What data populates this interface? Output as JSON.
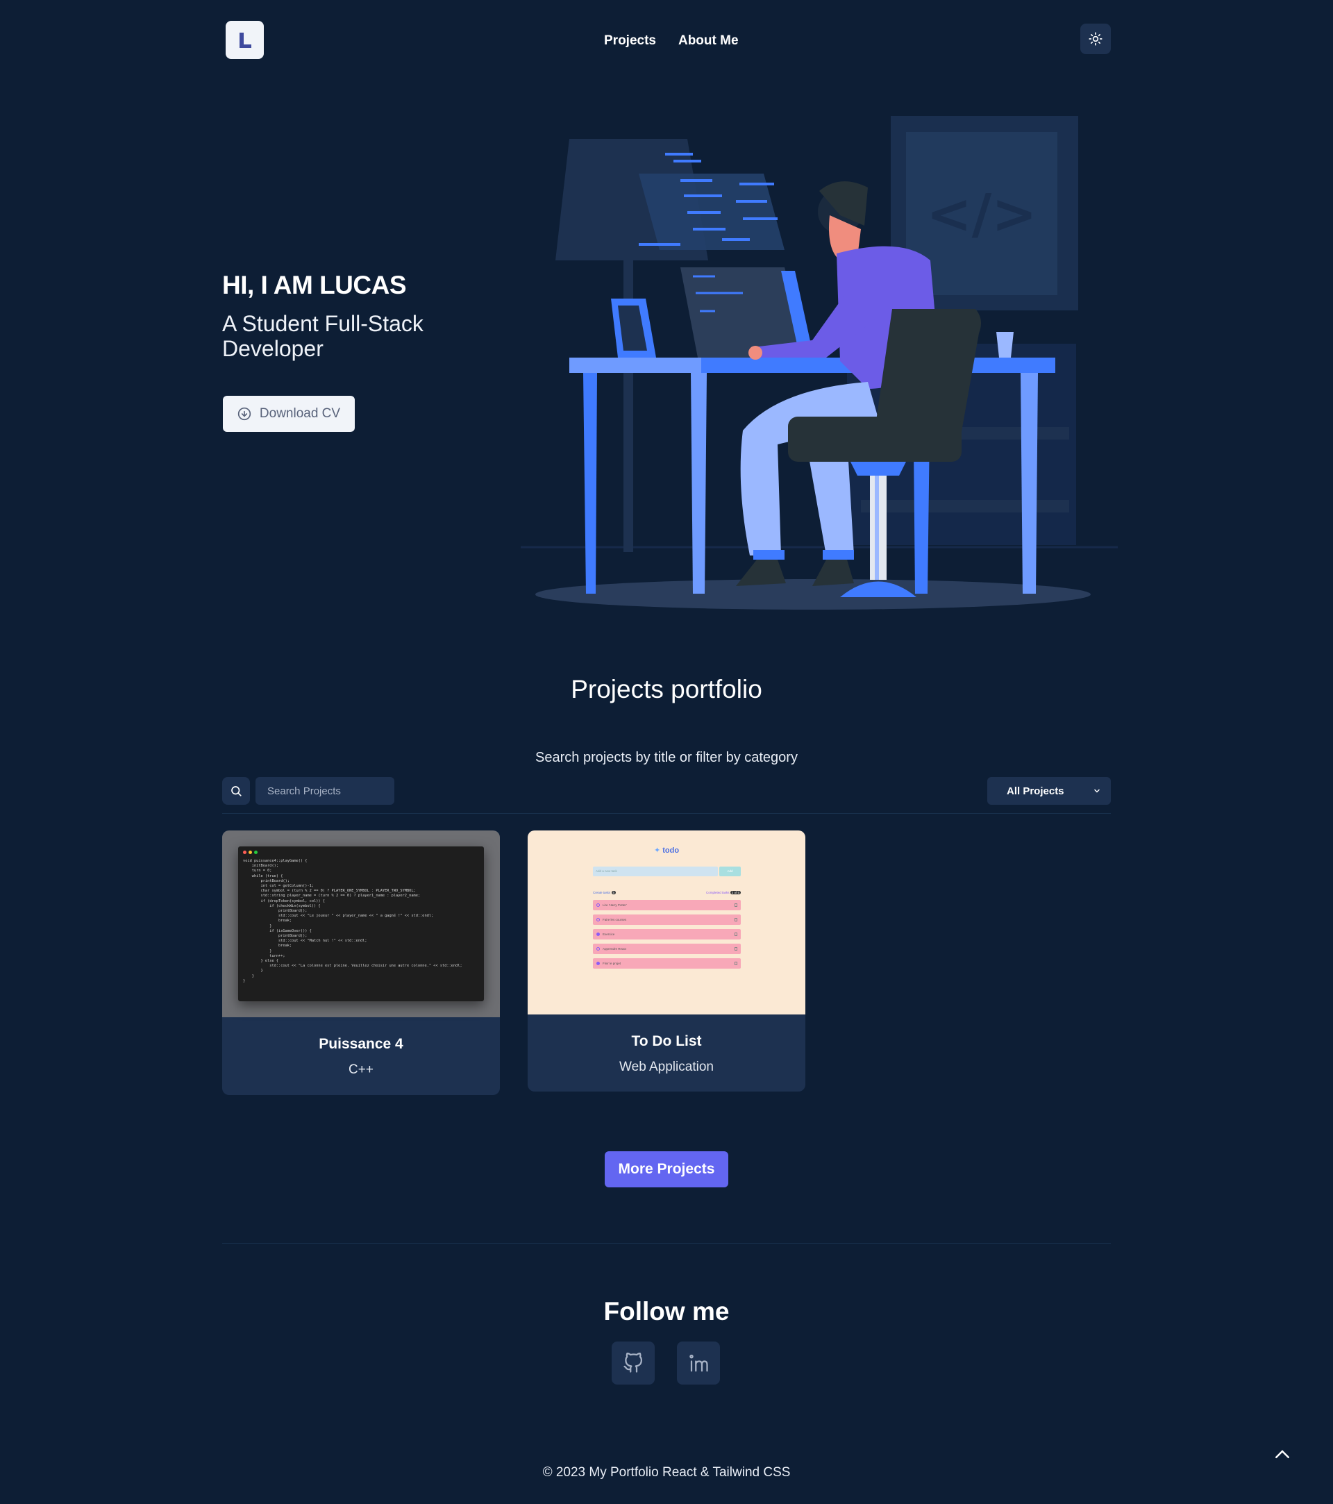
{
  "header": {
    "logo_letter": "L",
    "nav": [
      {
        "label": "Projects"
      },
      {
        "label": "About Me"
      }
    ],
    "theme_icon": "sun-icon"
  },
  "hero": {
    "title": "HI, I AM LUCAS",
    "subtitle": "A Student Full-Stack Developer",
    "cv_button": "Download CV",
    "cv_icon": "arrow-down-circle-icon",
    "illustration_code_symbol": "</>"
  },
  "projects": {
    "title": "Projects portfolio",
    "description": "Search projects by title or filter by category",
    "search_placeholder": "Search Projects",
    "filter_selected": "All Projects",
    "cards": [
      {
        "title": "Puissance 4",
        "category": "C++",
        "code_lines": [
          "void puissance4::playGame() {",
          "    initBoard();",
          "    turn = 0;",
          "    while (true) {",
          "        printBoard();",
          "        int col = getColumn()-1;",
          "        char symbol = (turn % 2 == 0) ? PLAYER_ONE_SYMBOL : PLAYER_TWO_SYMBOL;",
          "        std::string player_name = (turn % 2 == 0) ? player1_name : player2_name;",
          "        if (dropToken(symbol, col)) {",
          "            if (checkWin(symbol)) {",
          "                printBoard();",
          "                std::cout << \"Le joueur \" << player_name << \" a gagné !\" << std::endl;",
          "                break;",
          "            }",
          "            if (isGameOver()) {",
          "                printBoard();",
          "                std::cout << \"Match nul !\" << std::endl;",
          "                break;",
          "            }",
          "            turn++;",
          "        } else {",
          "            std::cout << \"La colonne est pleine. Veuillez choisir une autre colonne.\" << std::endl;",
          "        }",
          "    }",
          "}"
        ]
      },
      {
        "title": "To Do List",
        "category": "Web Application",
        "app_name": "todo",
        "input_placeholder": "Add a new task",
        "add_label": "Add",
        "created_label": "Create tasks",
        "created_count": "5",
        "completed_label": "Completed tasks",
        "completed_count": "2 of 5",
        "tasks": [
          "Lire 'Harry Potter'",
          "Faire les courses",
          "Exercice",
          "Apprendre React",
          "Finir le projet"
        ]
      }
    ],
    "more_button": "More Projects"
  },
  "follow": {
    "title": "Follow me",
    "icons": [
      "github-icon",
      "linkedin-icon"
    ]
  },
  "footer": {
    "text": "© 2023 My Portfolio React & Tailwind CSS",
    "to_top_icon": "chevron-up-icon"
  },
  "colors": {
    "background": "#0d1e35",
    "card": "#1d3150",
    "accent": "#6366f1",
    "illustration_blue": "#407bff",
    "illustration_purple": "#6c5ce7"
  }
}
